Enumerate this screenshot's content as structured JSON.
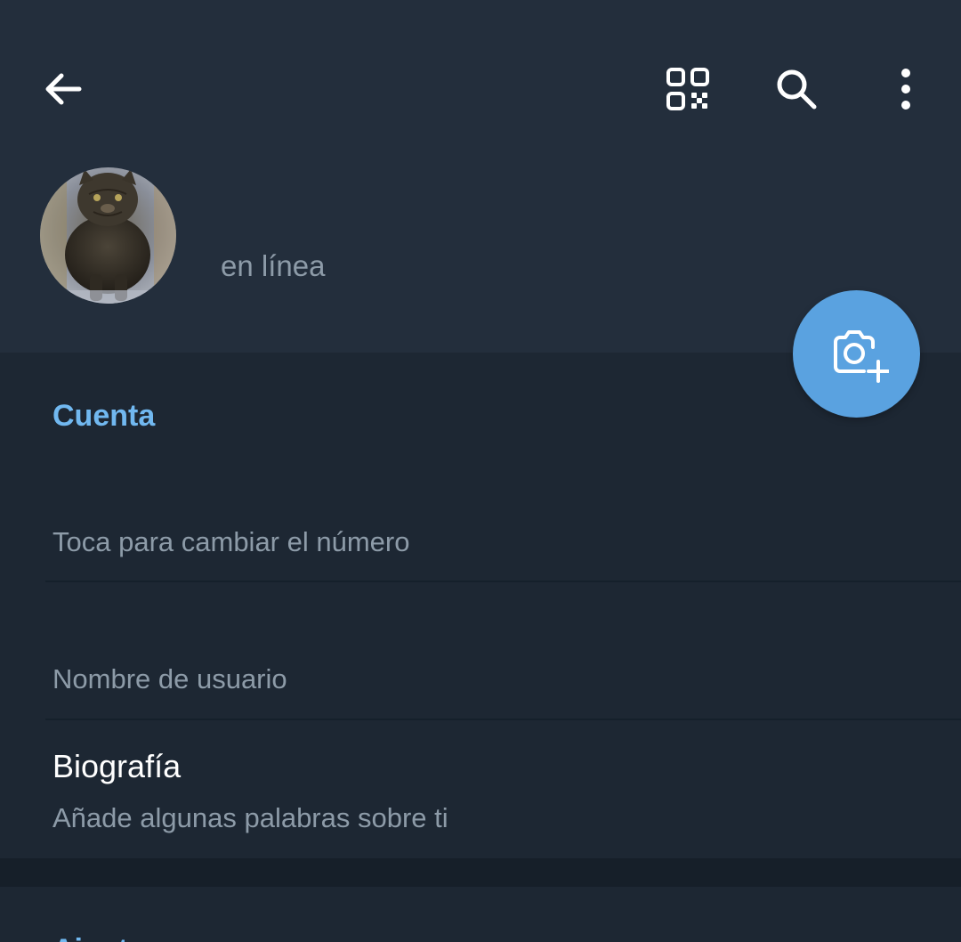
{
  "header": {
    "back_icon": "arrow-left-icon",
    "qr_icon": "qr-code-icon",
    "search_icon": "search-icon",
    "more_icon": "more-vertical-icon",
    "status": "en línea",
    "avatar_description": "cat-photo"
  },
  "fab": {
    "icon": "camera-add-icon",
    "color": "#5aa2e0"
  },
  "account": {
    "section_title": "Cuenta",
    "phone_hint": "Toca para cambiar el número",
    "username_hint": "Nombre de usuario",
    "bio_title": "Biografía",
    "bio_hint": "Añade algunas palabras sobre ti"
  },
  "next_section": {
    "title": "Ajustes"
  },
  "colors": {
    "header_bg": "#232e3c",
    "body_bg": "#1d2733",
    "accent": "#71b8f0",
    "secondary_text": "#8d9ba8"
  }
}
